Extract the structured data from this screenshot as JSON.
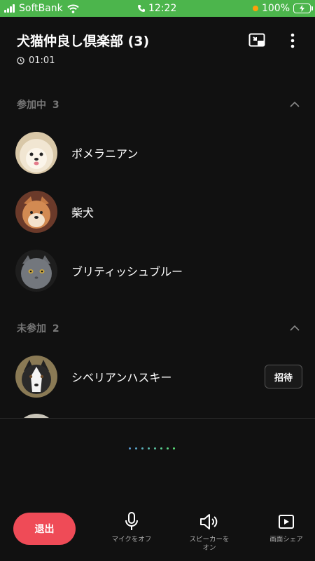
{
  "status_bar": {
    "carrier": "SoftBank",
    "time": "12:22",
    "battery": "100%"
  },
  "header": {
    "title": "犬猫仲良し倶楽部 (3)",
    "timer": "01:01"
  },
  "sections": {
    "joined": {
      "label": "参加中",
      "count": "3",
      "members": [
        {
          "name": "ポメラニアン"
        },
        {
          "name": "柴犬"
        },
        {
          "name": "ブリティッシュブルー"
        }
      ]
    },
    "not_joined": {
      "label": "未参加",
      "count": "2",
      "members": [
        {
          "name": "シベリアンハスキー",
          "invite_label": "招待"
        }
      ]
    }
  },
  "controls": {
    "leave_label": "退出",
    "mic_label": "マイクをオフ",
    "speaker_label": "スピーカーを\nオン",
    "share_label": "画面シェア"
  },
  "colors": {
    "status_bar": "#4cb54c",
    "background": "#111111",
    "leave_button": "#ef4b57"
  },
  "icons": [
    "wifi-icon",
    "phone-icon",
    "clock-icon",
    "minimize-icon",
    "more-icon",
    "chevron-up-icon",
    "mic-icon",
    "speaker-icon",
    "screen-share-icon"
  ]
}
